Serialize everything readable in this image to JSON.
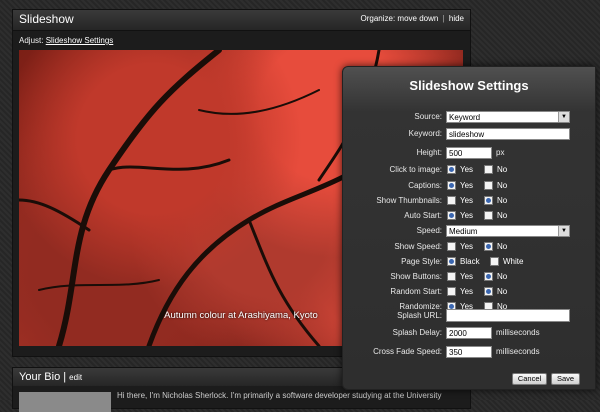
{
  "slideshow_panel": {
    "title": "Slideshow",
    "organize_label": "Organize:",
    "move_down": "move down",
    "separator": "|",
    "hide": "hide",
    "adjust_label": "Adjust:",
    "adjust_link": "Slideshow Settings",
    "caption": "Autumn colour at Arashiyama, Kyoto"
  },
  "bio_panel": {
    "title": "Your Bio",
    "separator": "|",
    "edit": "edit",
    "text": "Hi there, I'm Nicholas Sherlock. I'm primarily a software developer studying at the University"
  },
  "dialog": {
    "title": "Slideshow Settings",
    "source": {
      "label": "Source:",
      "value": "Keyword"
    },
    "keyword": {
      "label": "Keyword:",
      "value": "slideshow"
    },
    "height": {
      "label": "Height:",
      "value": "500",
      "unit": "px"
    },
    "click_to_image": {
      "label": "Click to image:",
      "yes": "Yes",
      "no": "No",
      "selected": "yes"
    },
    "captions": {
      "label": "Captions:",
      "yes": "Yes",
      "no": "No",
      "selected": "yes"
    },
    "show_thumbnails": {
      "label": "Show Thumbnails:",
      "yes": "Yes",
      "no": "No",
      "selected": "no"
    },
    "auto_start": {
      "label": "Auto Start:",
      "yes": "Yes",
      "no": "No",
      "selected": "yes"
    },
    "speed": {
      "label": "Speed:",
      "value": "Medium"
    },
    "show_speed": {
      "label": "Show Speed:",
      "yes": "Yes",
      "no": "No",
      "selected": "no"
    },
    "page_style": {
      "label": "Page Style:",
      "black": "Black",
      "white": "White",
      "selected": "black"
    },
    "show_buttons": {
      "label": "Show Buttons:",
      "yes": "Yes",
      "no": "No",
      "selected": "no"
    },
    "random_start": {
      "label": "Random Start:",
      "yes": "Yes",
      "no": "No",
      "selected": "no"
    },
    "randomize": {
      "label": "Randomize:",
      "yes": "Yes",
      "no": "No",
      "selected": "yes"
    },
    "splash_url": {
      "label": "Splash URL:",
      "value": ""
    },
    "splash_delay": {
      "label": "Splash Delay:",
      "value": "2000",
      "unit": "milliseconds"
    },
    "cross_fade_speed": {
      "label": "Cross Fade Speed:",
      "value": "350",
      "unit": "milliseconds"
    },
    "cancel_label": "Cancel",
    "save_label": "Save"
  }
}
